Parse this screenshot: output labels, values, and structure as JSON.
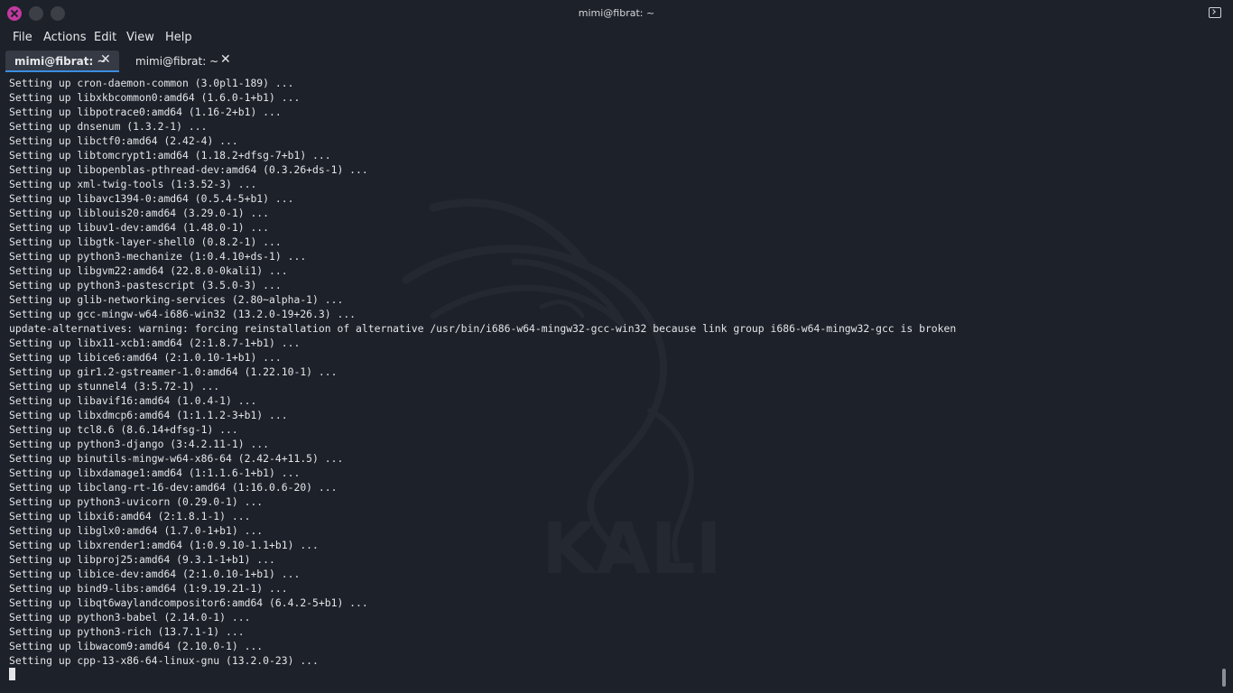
{
  "window": {
    "title": "mimi@fibrat: ~"
  },
  "menu": [
    "File",
    "Actions",
    "Edit",
    "View",
    "Help"
  ],
  "tabs": [
    {
      "label": "mimi@fibrat: ~",
      "active": true,
      "close": "✕"
    },
    {
      "label": "mimi@fibrat: ~",
      "active": false,
      "close": "✕"
    }
  ],
  "terminal": {
    "watermark_text": "KALI",
    "lines": [
      "Setting up cron-daemon-common (3.0pl1-189) ...",
      "Setting up libxkbcommon0:amd64 (1.6.0-1+b1) ...",
      "Setting up libpotrace0:amd64 (1.16-2+b1) ...",
      "Setting up dnsenum (1.3.2-1) ...",
      "Setting up libctf0:amd64 (2.42-4) ...",
      "Setting up libtomcrypt1:amd64 (1.18.2+dfsg-7+b1) ...",
      "Setting up libopenblas-pthread-dev:amd64 (0.3.26+ds-1) ...",
      "Setting up xml-twig-tools (1:3.52-3) ...",
      "Setting up libavc1394-0:amd64 (0.5.4-5+b1) ...",
      "Setting up liblouis20:amd64 (3.29.0-1) ...",
      "Setting up libuv1-dev:amd64 (1.48.0-1) ...",
      "Setting up libgtk-layer-shell0 (0.8.2-1) ...",
      "Setting up python3-mechanize (1:0.4.10+ds-1) ...",
      "Setting up libgvm22:amd64 (22.8.0-0kali1) ...",
      "Setting up python3-pastescript (3.5.0-3) ...",
      "Setting up glib-networking-services (2.80~alpha-1) ...",
      "Setting up gcc-mingw-w64-i686-win32 (13.2.0-19+26.3) ...",
      "update-alternatives: warning: forcing reinstallation of alternative /usr/bin/i686-w64-mingw32-gcc-win32 because link group i686-w64-mingw32-gcc is broken",
      "Setting up libx11-xcb1:amd64 (2:1.8.7-1+b1) ...",
      "Setting up libice6:amd64 (2:1.0.10-1+b1) ...",
      "Setting up gir1.2-gstreamer-1.0:amd64 (1.22.10-1) ...",
      "Setting up stunnel4 (3:5.72-1) ...",
      "Setting up libavif16:amd64 (1.0.4-1) ...",
      "Setting up libxdmcp6:amd64 (1:1.1.2-3+b1) ...",
      "Setting up tcl8.6 (8.6.14+dfsg-1) ...",
      "Setting up python3-django (3:4.2.11-1) ...",
      "Setting up binutils-mingw-w64-x86-64 (2.42-4+11.5) ...",
      "Setting up libxdamage1:amd64 (1:1.1.6-1+b1) ...",
      "Setting up libclang-rt-16-dev:amd64 (1:16.0.6-20) ...",
      "Setting up python3-uvicorn (0.29.0-1) ...",
      "Setting up libxi6:amd64 (2:1.8.1-1) ...",
      "Setting up libglx0:amd64 (1.7.0-1+b1) ...",
      "Setting up libxrender1:amd64 (1:0.9.10-1.1+b1) ...",
      "Setting up libproj25:amd64 (9.3.1-1+b1) ...",
      "Setting up libice-dev:amd64 (2:1.0.10-1+b1) ...",
      "Setting up bind9-libs:amd64 (1:9.19.21-1) ...",
      "Setting up libqt6waylandcompositor6:amd64 (6.4.2-5+b1) ...",
      "Setting up python3-babel (2.14.0-1) ...",
      "Setting up python3-rich (13.7.1-1) ...",
      "Setting up libwacom9:amd64 (2.10.0-1) ...",
      "Setting up cpp-13-x86-64-linux-gnu (13.2.0-23) ..."
    ]
  },
  "colors": {
    "background": "#1d2129",
    "text": "#e3e5e8",
    "close_button": "#c13aa0",
    "active_tab_accent": "#3b8de0"
  }
}
